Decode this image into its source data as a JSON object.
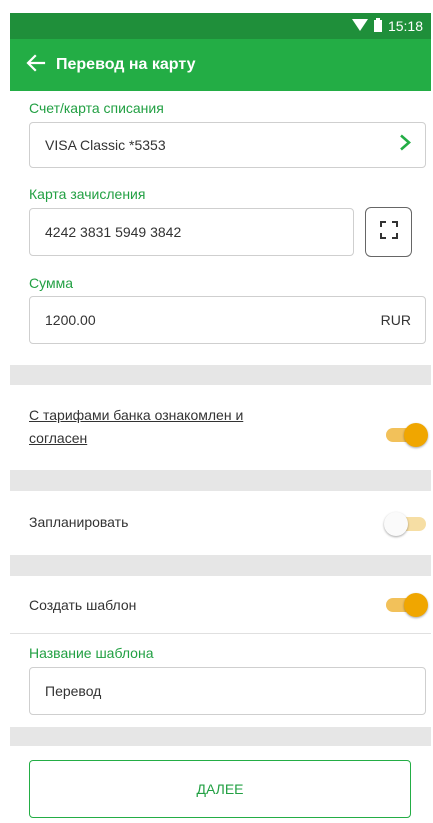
{
  "status_bar": {
    "time": "15:18",
    "icons": [
      "wifi-icon",
      "battery-icon"
    ]
  },
  "header": {
    "title": "Перевод на карту",
    "back_icon": "arrow-left-icon"
  },
  "form": {
    "debit_account": {
      "label": "Счет/карта списания",
      "value": "VISA Classic *5353"
    },
    "target_card": {
      "label": "Карта зачисления",
      "value": "4242 3831 5949 3842"
    },
    "amount": {
      "label": "Сумма",
      "value": "1200.00",
      "currency": "RUR"
    }
  },
  "toggles": {
    "terms": {
      "text_line1": "С тарифами банка ознакомлен и",
      "text_line2": "согласен",
      "on": true
    },
    "schedule": {
      "text": "Запланировать",
      "on": false
    },
    "create_template": {
      "text": "Создать шаблон",
      "on": true
    }
  },
  "template": {
    "label": "Название шаблона",
    "value": "Перевод"
  },
  "actions": {
    "next_label": "ДАЛЕЕ"
  },
  "colors": {
    "primary": "#23ad45",
    "status_bar": "#1f8f3a",
    "toggle_on": "#f0a600",
    "label_green": "#22a043"
  }
}
